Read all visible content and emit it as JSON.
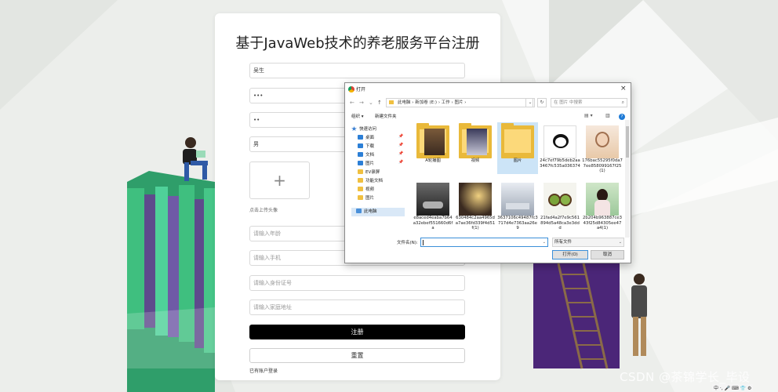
{
  "form": {
    "title": "基于JavaWeb技术的养老服务平台注册",
    "fields": {
      "username": "吴生",
      "password": "•••",
      "confirm_password": "••",
      "gender": "男",
      "age_placeholder": "请输入年龄",
      "phone_placeholder": "请输入手机",
      "id_placeholder": "请输入身份证号",
      "address_placeholder": "请输入家庭地址"
    },
    "upload_label": "点击上传头像",
    "register_button": "注册",
    "reset_button": "重置",
    "login_link": "已有账户登录"
  },
  "dialog": {
    "title": "打开",
    "close": "×",
    "address_path": "此电脑 › 新加卷 (E:) › 工作 › 图片 ›",
    "search_placeholder": "在 图片 中搜索",
    "toolbar": {
      "organize": "组织 ▾",
      "new_folder": "新建文件夹"
    },
    "nav_items": [
      {
        "label": "快速访问",
        "icon": "star-icon"
      },
      {
        "label": "桌面",
        "icon": "desktop-icon"
      },
      {
        "label": "下载",
        "icon": "download-icon"
      },
      {
        "label": "文档",
        "icon": "document-icon"
      },
      {
        "label": "图片",
        "icon": "picture-icon"
      },
      {
        "label": "EV录屏",
        "icon": "folder-icon"
      },
      {
        "label": "功能文档",
        "icon": "folder-icon"
      },
      {
        "label": "视频",
        "icon": "folder-icon"
      },
      {
        "label": "图片",
        "icon": "folder-icon"
      },
      {
        "label": "此电脑",
        "icon": "computer-icon"
      }
    ],
    "files": [
      {
        "name": "A轮播图",
        "kind": "folder"
      },
      {
        "name": "视频",
        "kind": "folder"
      },
      {
        "name": "图片",
        "kind": "folder"
      },
      {
        "name": "24c7ef79b5deb2aa3467fc535a036374",
        "kind": "image"
      },
      {
        "name": "176bac55295f0da77ee858099167f25(1)",
        "kind": "image"
      },
      {
        "name": "e8aced4eaba7b64a32ebef551660d6fa",
        "kind": "image"
      },
      {
        "name": "630484c2aa4965da7ae36fd339f4d51f(1)",
        "kind": "image"
      },
      {
        "name": "3637106c49487fc3717d4e7363aa26e9",
        "kind": "image"
      },
      {
        "name": "21fad4a2f7e9c561894d5a48ca3e3ddd",
        "kind": "image"
      },
      {
        "name": "2b204b963887ce343f25d84305ee47a4(1)",
        "kind": "image"
      }
    ],
    "filename_label": "文件名(N):",
    "filename_value": "",
    "filetype": "所有文件",
    "open_button": "打开(O)",
    "cancel_button": "取消"
  },
  "watermark": "CSDN @茶锦学长_毕设",
  "ime": "中 ·, 🎤 ⌨ 👕 ⚙",
  "colors": {
    "register_btn": "#000000",
    "books_green": "#3fbf7f",
    "books_purple": "#5e4a8c",
    "dialog_accent": "#3c8fd8",
    "folder": "#e9b93a"
  }
}
